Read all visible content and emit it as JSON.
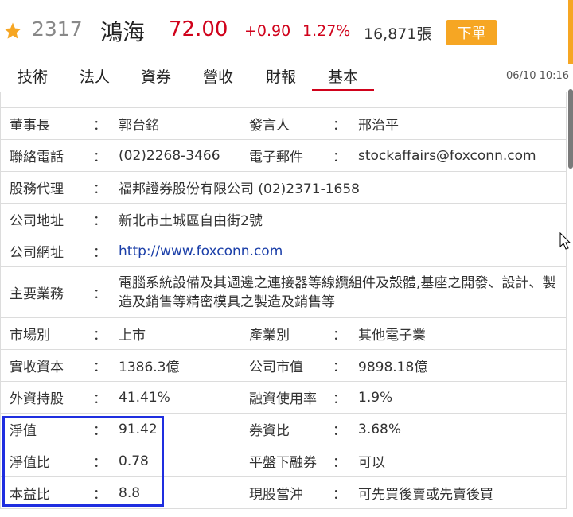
{
  "header": {
    "code": "2317",
    "name": "鴻海",
    "price": "72.00",
    "change": "+0.90",
    "change_pct": "1.27%",
    "volume": "16,871張",
    "order_button": "下單",
    "favorite_icon": "star-icon",
    "price_color": "#d0021b",
    "accent_color": "#f6a623"
  },
  "tabs": {
    "items": [
      "技術",
      "法人",
      "資券",
      "營收",
      "財報",
      "基本"
    ],
    "active": "基本",
    "timestamp": "06/10 10:16"
  },
  "info": {
    "sep": "：",
    "chairman_label": "董事長",
    "chairman": "郭台銘",
    "spokesperson_label": "發言人",
    "spokesperson": "邢治平",
    "phone_label": "聯絡電話",
    "phone": "(02)2268-3466",
    "email_label": "電子郵件",
    "email": "stockaffairs@foxconn.com",
    "agent_label": "股務代理",
    "agent": "福邦證券股份有限公司 (02)2371-1658",
    "address_label": "公司地址",
    "address": "新北市土城區自由街2號",
    "website_label": "公司網址",
    "website": "http://www.foxconn.com",
    "business_label": "主要業務",
    "business": "電腦系統設備及其週邊之連接器等線纜組件及殼體,基座之開發、設計、製造及銷售等精密模具之製造及銷售等",
    "market_label": "市場別",
    "market": "上市",
    "industry_label": "產業別",
    "industry": "其他電子業",
    "capital_label": "實收資本",
    "capital": "1386.3億",
    "market_cap_label": "公司市值",
    "market_cap": "9898.18億",
    "foreign_label": "外資持股",
    "foreign": "41.41%",
    "margin_usage_label": "融資使用率",
    "margin_usage": "1.9%",
    "nav_label": "淨值",
    "nav": "91.42",
    "short_ratio_label": "券資比",
    "short_ratio": "3.68%",
    "pb_label": "淨值比",
    "pb": "0.78",
    "short_below_label": "平盤下融券",
    "short_below": "可以",
    "pe_label": "本益比",
    "pe": "8.8",
    "day_trade_label": "現股當沖",
    "day_trade": "可先買後賣或先賣後買"
  },
  "highlight_color": "#1f2ee0",
  "link_color": "#1a3ea8"
}
